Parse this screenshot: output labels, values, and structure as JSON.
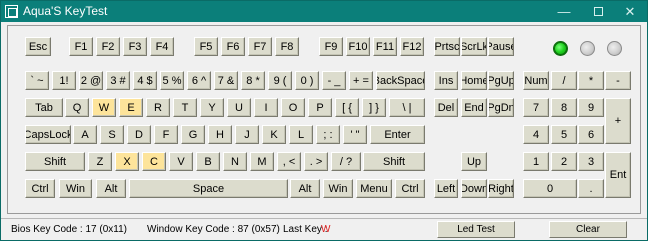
{
  "window": {
    "title": "Aqua'S KeyTest",
    "minimize_glyph": "—",
    "close_glyph": "✕"
  },
  "keys": {
    "esc": "Esc",
    "f1": "F1",
    "f2": "F2",
    "f3": "F3",
    "f4": "F4",
    "f5": "F5",
    "f6": "F6",
    "f7": "F7",
    "f8": "F8",
    "f9": "F9",
    "f10": "F10",
    "f11": "F11",
    "f12": "F12",
    "prtsc": "Prtsc",
    "scrlk": "ScrLk",
    "pause": "Pause",
    "backtick": "` ~",
    "k1": "1!",
    "k2": "2 @",
    "k3": "3 #",
    "k4": "4 $",
    "k5": "5 %",
    "k6": "6 ^",
    "k7": "7 &",
    "k8": "8 *",
    "k9": "9 (",
    "k0": "0 )",
    "minus": "- _",
    "equals": "+ =",
    "backspace": "BackSpace",
    "ins": "Ins",
    "home": "Home",
    "pgup": "PgUp",
    "numlock": "Num",
    "num_div": "/",
    "num_mul": "*",
    "num_sub": "-",
    "tab": "Tab",
    "q": "Q",
    "w": "W",
    "e": "E",
    "r": "R",
    "t": "T",
    "y": "Y",
    "u": "U",
    "i": "I",
    "o": "O",
    "p": "P",
    "lbracket": "[ {",
    "rbracket": "] }",
    "backslash": "\\ |",
    "del": "Del",
    "end": "End",
    "pgdn": "PgDn",
    "num7": "7",
    "num8": "8",
    "num9": "9",
    "num_add": "+",
    "capslock": "CapsLock",
    "a": "A",
    "s": "S",
    "d": "D",
    "f": "F",
    "g": "G",
    "h": "H",
    "j": "J",
    "k": "K",
    "l": "L",
    "semicolon": "; :",
    "quote": "' \"",
    "enter": "Enter",
    "num4": "4",
    "num5": "5",
    "num6": "6",
    "lshift": "Shift",
    "z": "Z",
    "x": "X",
    "c": "C",
    "v": "V",
    "b": "B",
    "n": "N",
    "m": "M",
    "comma": ", <",
    "period": ". >",
    "slash": "/ ?",
    "rshift": "Shift",
    "up": "Up",
    "num1": "1",
    "num2": "2",
    "num3": "3",
    "num_enter": "Ent",
    "lctrl": "Ctrl",
    "lwin": "Win",
    "lalt": "Alt",
    "space": "Space",
    "ralt": "Alt",
    "rwin": "Win",
    "menu": "Menu",
    "rctrl": "Ctrl",
    "left": "Left",
    "down": "Down",
    "right": "Right",
    "num0": "0",
    "num_dot": "."
  },
  "pressed_keys": [
    "w",
    "e",
    "x",
    "c"
  ],
  "leds": [
    {
      "name": "num-lock-led",
      "on": true
    },
    {
      "name": "caps-lock-led",
      "on": false
    },
    {
      "name": "scroll-lock-led",
      "on": false
    }
  ],
  "status": {
    "bios_key_code": "Bios Key Code : 17 (0x11)",
    "window_key_code": "Window Key Code : 87 (0x57)",
    "last_key_label": "Last Key :",
    "last_key_value": "W",
    "led_test_button": "Led Test",
    "clear_button": "Clear"
  },
  "colors": {
    "titlebar": "#0b7f7a",
    "key_face": "#dcdccd",
    "key_pressed": "#fde49b",
    "led_on": "#1ed11e",
    "last_key_text": "#e02020"
  }
}
